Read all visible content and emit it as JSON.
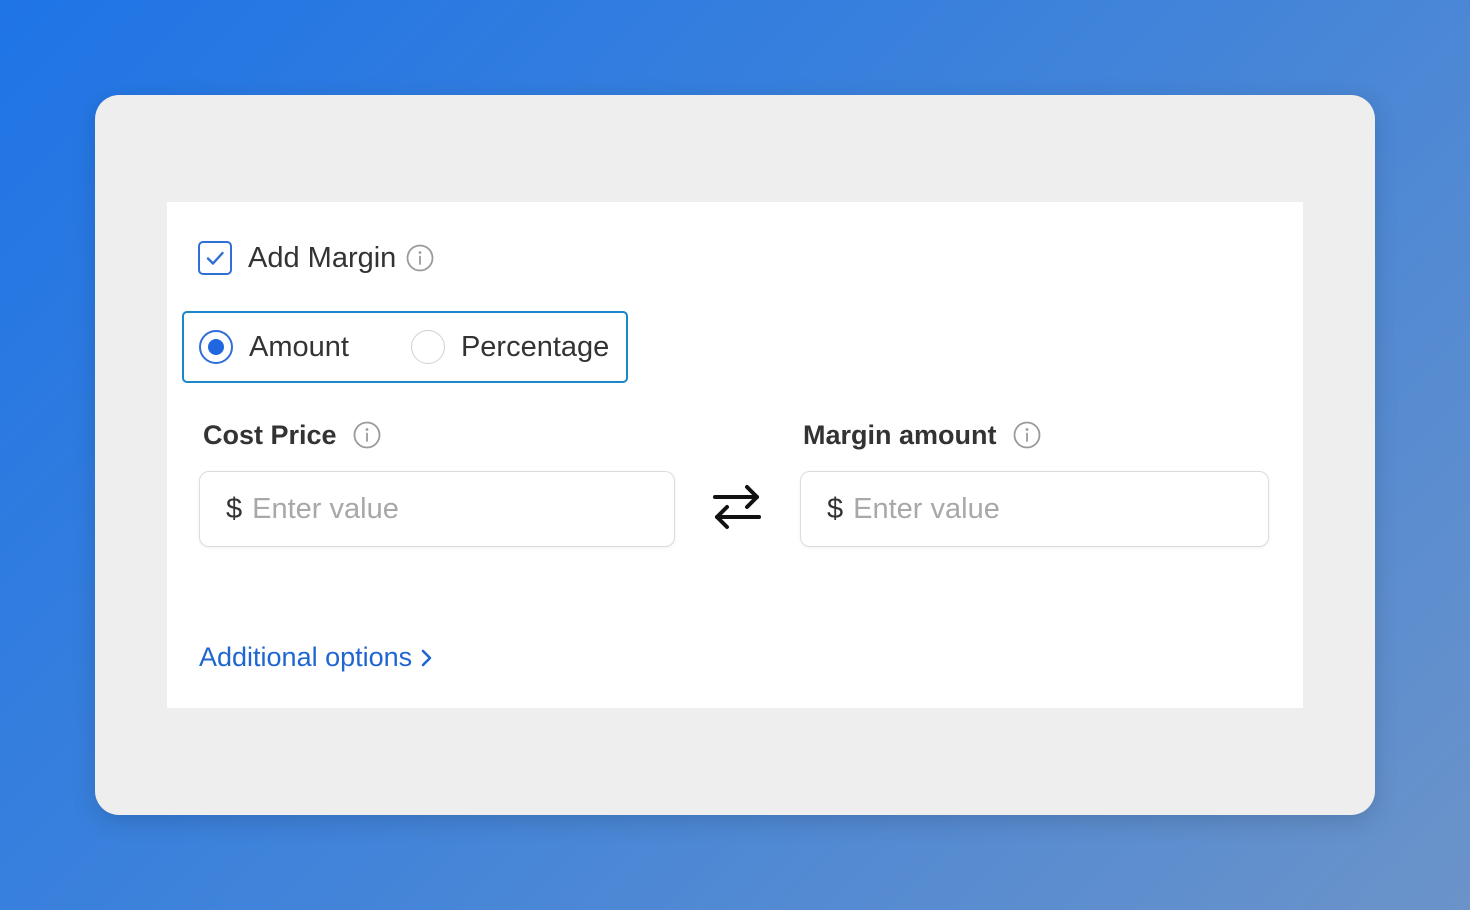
{
  "margin_toggle": {
    "label": "Add Margin",
    "checked": true,
    "info_icon": "info-icon"
  },
  "margin_type": {
    "options": [
      {
        "label": "Amount",
        "selected": true
      },
      {
        "label": "Percentage",
        "selected": false
      }
    ]
  },
  "cost_price": {
    "label": "Cost Price",
    "currency": "$",
    "placeholder": "Enter value",
    "value": ""
  },
  "margin_amount": {
    "label": "Margin amount",
    "currency": "$",
    "placeholder": "Enter value",
    "value": ""
  },
  "swap_icon": "swap-arrows-icon",
  "additional_options": {
    "label": "Additional options",
    "icon": "chevron-right-icon"
  },
  "colors": {
    "accent": "#1f66e0",
    "link": "#1f66d1",
    "radio_group_border": "#1b86c8",
    "background_start": "#1f74e6",
    "background_end": "#6b93c9"
  }
}
